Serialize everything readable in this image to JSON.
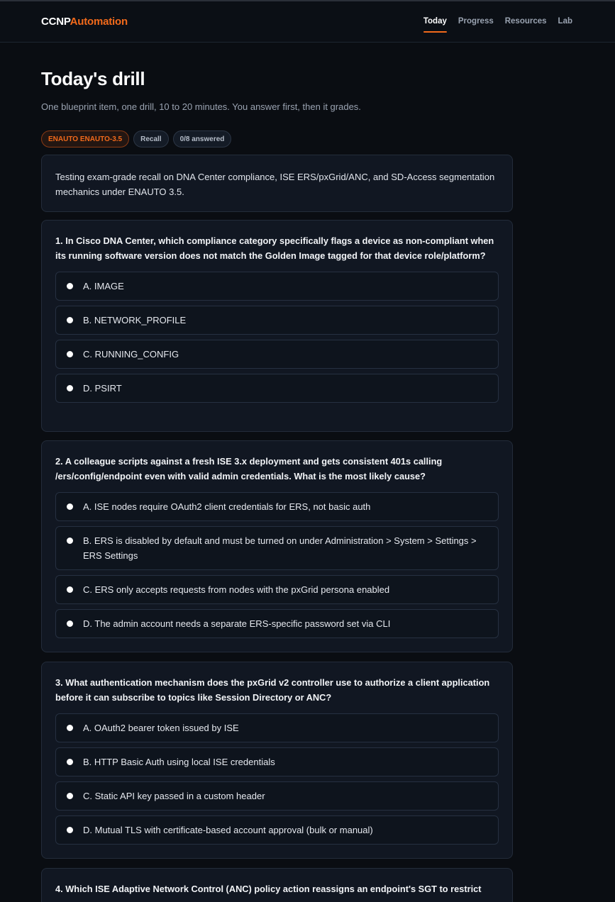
{
  "brand": {
    "part1": "CCNP",
    "part2": "Automation",
    "accent_color": "#f26a1b"
  },
  "nav": [
    {
      "label": "Today",
      "active": true
    },
    {
      "label": "Progress",
      "active": false
    },
    {
      "label": "Resources",
      "active": false
    },
    {
      "label": "Lab",
      "active": false
    }
  ],
  "page": {
    "title": "Today's drill",
    "subtitle": "One blueprint item, one drill, 10 to 20 minutes. You answer first, then it grades."
  },
  "chips": {
    "blueprint": "ENAUTO ENAUTO-3.5",
    "mode": "Recall",
    "progress": "0/8 answered"
  },
  "intro": "Testing exam-grade recall on DNA Center compliance, ISE ERS/pxGrid/ANC, and SD-Access segmentation mechanics under ENAUTO 3.5.",
  "questions": [
    {
      "text": "1. In Cisco DNA Center, which compliance category specifically flags a device as non-compliant when its running software version does not match the Golden Image tagged for that device role/platform?",
      "options": [
        "A. IMAGE",
        "B. NETWORK_PROFILE",
        "C. RUNNING_CONFIG",
        "D. PSIRT"
      ]
    },
    {
      "text": "2. A colleague scripts against a fresh ISE 3.x deployment and gets consistent 401s calling /ers/config/endpoint even with valid admin credentials. What is the most likely cause?",
      "options": [
        "A. ISE nodes require OAuth2 client credentials for ERS, not basic auth",
        "B. ERS is disabled by default and must be turned on under Administration > System > Settings > ERS Settings",
        "C. ERS only accepts requests from nodes with the pxGrid persona enabled",
        "D. The admin account needs a separate ERS-specific password set via CLI"
      ]
    },
    {
      "text": "3. What authentication mechanism does the pxGrid v2 controller use to authorize a client application before it can subscribe to topics like Session Directory or ANC?",
      "options": [
        "A. OAuth2 bearer token issued by ISE",
        "B. HTTP Basic Auth using local ISE credentials",
        "C. Static API key passed in a custom header",
        "D. Mutual TLS with certificate-based account approval (bulk or manual)"
      ]
    },
    {
      "text": "4. Which ISE Adaptive Network Control (ANC) policy action reassigns an endpoint's SGT to restrict",
      "options": []
    }
  ]
}
